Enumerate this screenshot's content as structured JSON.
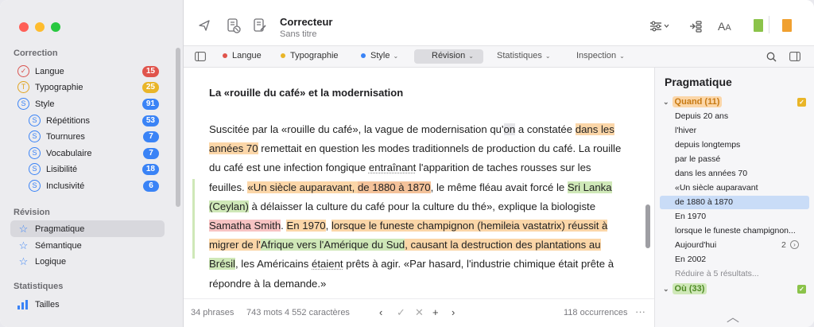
{
  "window": {
    "title": "Correcteur",
    "subtitle": "Sans titre"
  },
  "sidebar": {
    "sections": [
      {
        "title": "Correction",
        "items": [
          {
            "label": "Langue",
            "count": "15",
            "icon": "langue-check-icon",
            "color": "#e0544c"
          },
          {
            "label": "Typographie",
            "count": "25",
            "icon": "typographie-t-icon",
            "color": "#e9b528"
          },
          {
            "label": "Style",
            "count": "91",
            "icon": "style-s-icon",
            "color": "#3a83f6"
          },
          {
            "label": "Répétitions",
            "count": "53",
            "icon": "style-s-icon",
            "color": "#3a83f6"
          },
          {
            "label": "Tournures",
            "count": "7",
            "icon": "style-s-icon",
            "color": "#3a83f6"
          },
          {
            "label": "Vocabulaire",
            "count": "7",
            "icon": "style-s-icon",
            "color": "#3a83f6"
          },
          {
            "label": "Lisibilité",
            "count": "18",
            "icon": "style-s-icon",
            "color": "#3a83f6"
          },
          {
            "label": "Inclusivité",
            "count": "6",
            "icon": "style-s-icon",
            "color": "#3a83f6"
          }
        ]
      },
      {
        "title": "Révision",
        "items": [
          {
            "label": "Pragmatique",
            "icon": "star-icon"
          },
          {
            "label": "Sémantique",
            "icon": "star-icon"
          },
          {
            "label": "Logique",
            "icon": "star-icon"
          }
        ]
      },
      {
        "title": "Statistiques",
        "items": [
          {
            "label": "Tailles",
            "icon": "bar-chart-icon"
          }
        ]
      }
    ]
  },
  "filterbar": {
    "langue": "Langue",
    "typographie": "Typographie",
    "style": "Style",
    "revision": "Révision",
    "statistiques": "Statistiques",
    "inspection": "Inspection"
  },
  "document": {
    "heading": "La «rouille du café» et la modernisation",
    "segments": [
      {
        "t": "Suscitée par la «rouille du café», la vague de modernisation qu'",
        "c": ""
      },
      {
        "t": "on",
        "c": "hl-gy"
      },
      {
        "t": " a constatée ",
        "c": ""
      },
      {
        "t": "dans les années 70",
        "c": "hl-or"
      },
      {
        "t": " remettait en question les modes traditionnels de production du café. La rouille du café est une infection fongique ",
        "c": ""
      },
      {
        "t": "entraînant",
        "c": "ul-dot"
      },
      {
        "t": " l'apparition de taches rousses sur les feuilles. ",
        "c": ""
      },
      {
        "t": "«Un siècle auparavant, ",
        "c": "hl-or"
      },
      {
        "t": "de 1880 à 1870",
        "c": "hl-sel"
      },
      {
        "t": ", le même fléau avait forcé le ",
        "c": ""
      },
      {
        "t": "Sri Lanka (Ceylan)",
        "c": "hl-gr"
      },
      {
        "t": " à délaisser la culture du café pour la culture du thé», explique la biologiste ",
        "c": ""
      },
      {
        "t": "Samatha Smith",
        "c": "hl-pk"
      },
      {
        "t": ". ",
        "c": ""
      },
      {
        "t": "En 1970",
        "c": "hl-or"
      },
      {
        "t": ", ",
        "c": ""
      },
      {
        "t": "lorsque le funeste champignon (hemileia vastatrix) réussit à migrer de l'",
        "c": "hl-or"
      },
      {
        "t": "Afrique",
        "c": "hl-gr"
      },
      {
        "t": " vers l'Amérique du Sud",
        "c": "hl-gr"
      },
      {
        "t": ", causant la destruction des plantations au ",
        "c": "hl-or"
      },
      {
        "t": "Brésil",
        "c": "hl-gr"
      },
      {
        "t": ", les Américains ",
        "c": ""
      },
      {
        "t": "étaient",
        "c": "ul-dot"
      },
      {
        "t": " prêts à agir. «Par hasard, l'industrie chimique était prête à répondre à la demande.»",
        "c": ""
      }
    ]
  },
  "status": {
    "phrases": "34 phrases",
    "mots": "743 mots",
    "caracteres": "4 552 caractères",
    "occurrences": "118 occurrences"
  },
  "panel": {
    "title": "Pragmatique",
    "group1": {
      "label": "Quand (11)",
      "color": "#e9b528"
    },
    "items": [
      "Depuis 20 ans",
      "l'hiver",
      "depuis longtemps",
      "par le passé",
      "dans les années 70",
      "«Un siècle auparavant",
      "de 1880 à 1870",
      "En 1970",
      "lorsque le funeste champignon...",
      "Aujourd'hui",
      "En 2002",
      "Réduire à 5 résultats..."
    ],
    "aujourdhui_count": "2",
    "group2": {
      "label": "Où (33)",
      "color": "#8bc34a"
    }
  }
}
